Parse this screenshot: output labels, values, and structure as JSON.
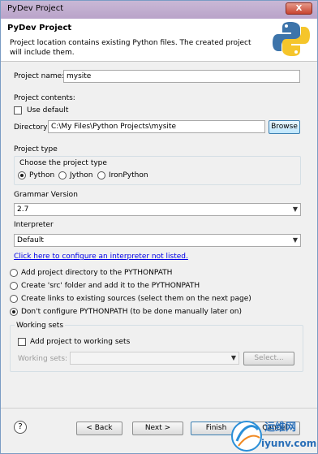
{
  "window": {
    "title": "PyDev Project",
    "close_label": "X"
  },
  "header": {
    "message": "Project location contains existing Python files. The created project will include them."
  },
  "project_name": {
    "label": "Project name:",
    "value": "mysite"
  },
  "project_contents": {
    "label": "Project contents:",
    "use_default_label": "Use default",
    "directory_label": "Directory",
    "directory_value": "C:\\My Files\\Python Projects\\mysite",
    "browse_label": "Browse"
  },
  "project_type": {
    "label": "Project type",
    "group_label": "Choose the project type",
    "options": [
      "Python",
      "Jython",
      "IronPython"
    ],
    "selected": "Python"
  },
  "grammar": {
    "label": "Grammar Version",
    "value": "2.7"
  },
  "interpreter": {
    "label": "Interpreter",
    "value": "Default",
    "configure_link": "Click here to configure an interpreter not listed."
  },
  "pythonpath": {
    "options": [
      "Add project directory to the PYTHONPATH",
      "Create 'src' folder and add it to the PYTHONPATH",
      "Create links to existing sources (select them on the next page)",
      "Don't configure PYTHONPATH (to be done manually later on)"
    ],
    "selected_index": 3
  },
  "working_sets": {
    "label": "Working sets",
    "add_label": "Add project to working sets",
    "sets_label": "Working sets:",
    "select_label": "Select..."
  },
  "footer": {
    "help_label": "?",
    "back_label": "< Back",
    "next_label": "Next >",
    "finish_label": "Finish",
    "cancel_label": "Cancel"
  },
  "watermark": {
    "text1": "运维网",
    "text2": "iyunv.com"
  },
  "colors": {
    "link": "#0000e6",
    "title_bar": "#c9b8d6",
    "close": "#c8442f"
  }
}
